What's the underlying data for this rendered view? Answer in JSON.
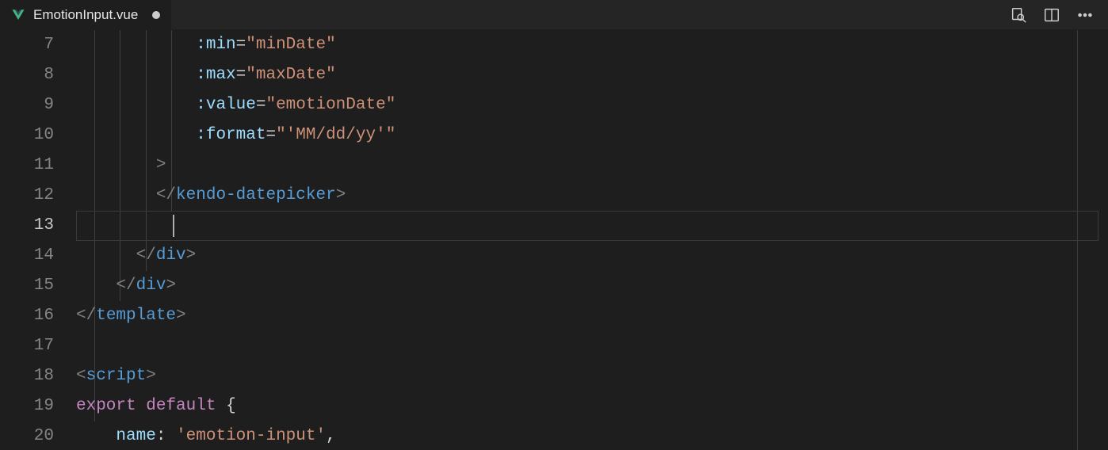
{
  "tab": {
    "filename": "EmotionInput.vue",
    "dirty": true
  },
  "lineNumbers": [
    "7",
    "8",
    "9",
    "10",
    "11",
    "12",
    "13",
    "14",
    "15",
    "16",
    "17",
    "18",
    "19",
    "20"
  ],
  "activeLine": "13",
  "code": {
    "l7": {
      "attr": ":min",
      "val": "\"minDate\""
    },
    "l8": {
      "attr": ":max",
      "val": "\"maxDate\""
    },
    "l9": {
      "attr": ":value",
      "val": "\"emotionDate\""
    },
    "l10": {
      "attr": ":format",
      "valOpen": "\"",
      "valInner": "'MM/dd/yy'",
      "valClose": "\""
    },
    "l11": {
      "gt": ">"
    },
    "l12": {
      "open": "</",
      "tag": "kendo-datepicker",
      "close": ">"
    },
    "l14": {
      "open": "</",
      "tag": "div",
      "close": ">"
    },
    "l15": {
      "open": "</",
      "tag": "div",
      "close": ">"
    },
    "l16": {
      "open": "</",
      "tag": "template",
      "close": ">"
    },
    "l18": {
      "lt": "<",
      "tag": "script",
      "gt": ">"
    },
    "l19": {
      "kwExport": "export",
      "sp1": " ",
      "kwDefault": "default",
      "sp2": " ",
      "brace": "{"
    },
    "l20": {
      "prop": "name",
      "colon": ":",
      "val": "'emotion-input'",
      "comma": ","
    }
  }
}
